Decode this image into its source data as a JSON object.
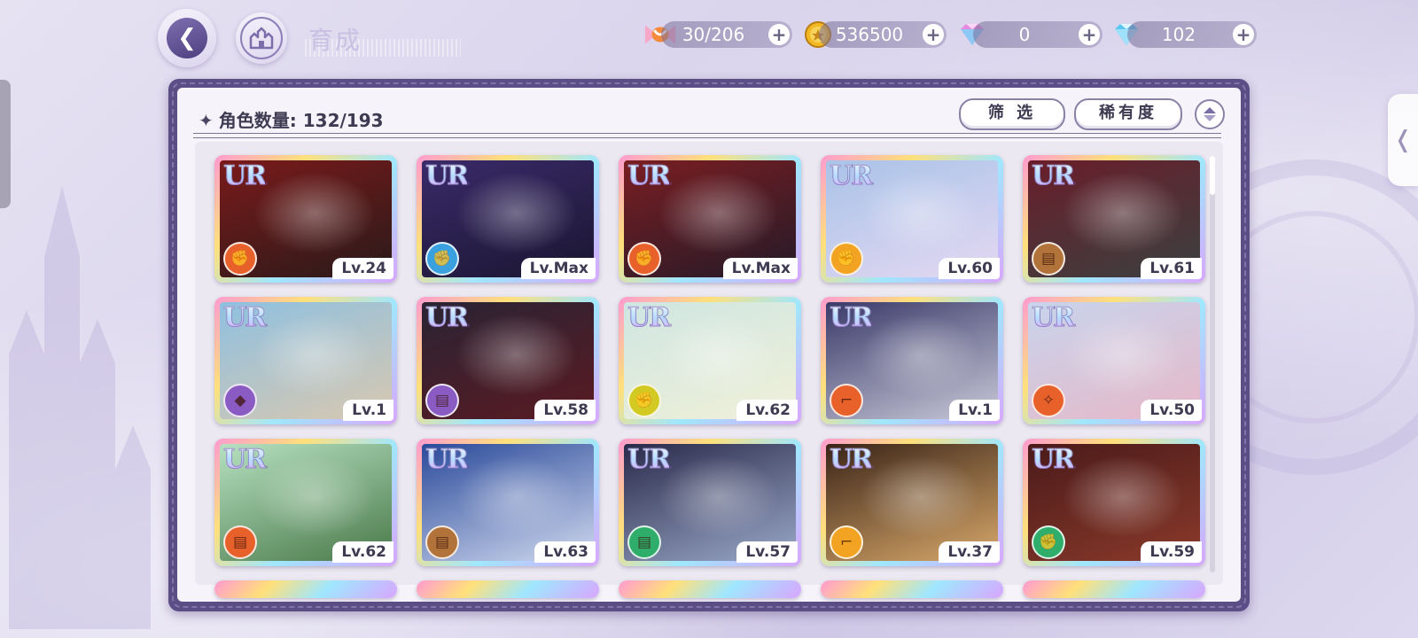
{
  "header": {
    "title": "育成",
    "resources": [
      {
        "name": "stamina",
        "value": "30/206",
        "icon": "candy-icon"
      },
      {
        "name": "gold",
        "value": "536500",
        "icon": "gold-coin-icon"
      },
      {
        "name": "paid-gem",
        "value": "0",
        "icon": "rainbow-gem-icon"
      },
      {
        "name": "free-gem",
        "value": "102",
        "icon": "diamond-icon"
      }
    ]
  },
  "panel": {
    "count_label": "角色数量:",
    "count_value": "132/193",
    "filter_label": "筛 选",
    "rarity_label": "稀有度"
  },
  "attr_colors": {
    "red": "#e8612b",
    "blue": "#3aa0de",
    "yellow": "#f2a321",
    "brown": "#b2733a",
    "purple": "#8a5bc2",
    "green": "#2eae6a",
    "lime": "#d2c923"
  },
  "cards": [
    {
      "rarity": "UR",
      "level": "Lv.24",
      "attr": "red",
      "attr_icon": "fist-icon"
    },
    {
      "rarity": "UR",
      "level": "Lv.Max",
      "attr": "blue",
      "attr_icon": "fist-icon"
    },
    {
      "rarity": "UR",
      "level": "Lv.Max",
      "attr": "red",
      "attr_icon": "fist-icon"
    },
    {
      "rarity": "UR",
      "level": "Lv.60",
      "attr": "yellow",
      "attr_icon": "fist-icon"
    },
    {
      "rarity": "UR",
      "level": "Lv.61",
      "attr": "brown",
      "attr_icon": "book-icon"
    },
    {
      "rarity": "UR",
      "level": "Lv.1",
      "attr": "purple",
      "attr_icon": "gem-icon"
    },
    {
      "rarity": "UR",
      "level": "Lv.58",
      "attr": "purple",
      "attr_icon": "book-icon"
    },
    {
      "rarity": "UR",
      "level": "Lv.62",
      "attr": "lime",
      "attr_icon": "fist-icon"
    },
    {
      "rarity": "UR",
      "level": "Lv.1",
      "attr": "red",
      "attr_icon": "boot-icon"
    },
    {
      "rarity": "UR",
      "level": "Lv.50",
      "attr": "red",
      "attr_icon": "wand-icon"
    },
    {
      "rarity": "UR",
      "level": "Lv.62",
      "attr": "red",
      "attr_icon": "book-icon"
    },
    {
      "rarity": "UR",
      "level": "Lv.63",
      "attr": "brown",
      "attr_icon": "book-icon"
    },
    {
      "rarity": "UR",
      "level": "Lv.57",
      "attr": "green",
      "attr_icon": "book-icon"
    },
    {
      "rarity": "UR",
      "level": "Lv.37",
      "attr": "yellow",
      "attr_icon": "boot-icon"
    },
    {
      "rarity": "UR",
      "level": "Lv.59",
      "attr": "green",
      "attr_icon": "fist-icon"
    }
  ]
}
